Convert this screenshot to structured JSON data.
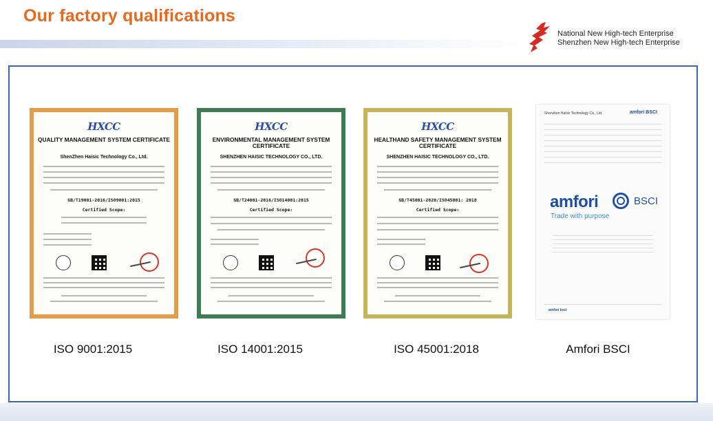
{
  "header": {
    "title": "Our factory qualifications",
    "enterprise_line1": "National New High-tech Enterprise",
    "enterprise_line2": "Shenzhen New High-tech Enterprise",
    "logo_icon": "high-tech-enterprise-logo-icon"
  },
  "colors": {
    "title_orange": "#e8691c",
    "frame_blue": "#3c63b4",
    "amfori_blue": "#1d4fa1",
    "seal_red": "#d8352a"
  },
  "certificates": [
    {
      "logo_text": "HXCC",
      "title": "QUALITY MANAGEMENT SYSTEM CERTIFICATE",
      "company": "ShenZhen Haisic Technology Co., Ltd.",
      "standard": "GB/T19001-2016/ISO9001:2015",
      "scope_head": "Certified Scope:",
      "border_color": "#e59c48",
      "caption": "ISO 9001:2015"
    },
    {
      "logo_text": "HXCC",
      "title": "ENVIRONMENTAL MANAGEMENT SYSTEM CERTIFICATE",
      "company": "SHENZHEN HAISIC TECHNOLOGY CO., LTD.",
      "standard": "GB/T24001-2016/ISO14001:2015",
      "scope_head": "Certified Scope:",
      "border_color": "#3f7c54",
      "caption": "ISO 14001:2015"
    },
    {
      "logo_text": "HXCC",
      "title": "HEALTHAND SAFETY MANAGEMENT SYSTEM CERTIFICATE",
      "company": "SHENZHEN HAISIC TECHNOLOGY CO., LTD.",
      "standard": "GB/T45001-2020/ISO45001: 2018",
      "scope_head": "Certified Scope:",
      "border_color": "#c8b45a",
      "caption": "ISO 45001:2018"
    }
  ],
  "amfori": {
    "producer_line": "Shenzhen Haisic Technology Co., Ltd.",
    "small_logo": "amfori BSCI",
    "brand": "amfori",
    "bsci": "BSCI",
    "tagline": "Trade with purpose",
    "footer_logo": "amfori bsci",
    "caption": "Amfori BSCI"
  }
}
